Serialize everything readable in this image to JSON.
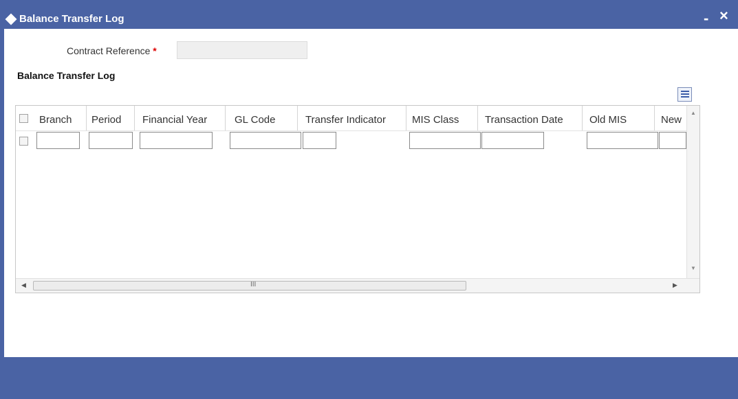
{
  "window": {
    "title": "Balance Transfer Log",
    "minimize_label": "-",
    "close_label": "×"
  },
  "form": {
    "contract_reference_label": "Contract Reference",
    "required_mark": "*",
    "contract_reference_value": ""
  },
  "section": {
    "title": "Balance Transfer Log"
  },
  "grid": {
    "columns": [
      "Branch",
      "Period",
      "Financial Year",
      "GL Code",
      "Transfer Indicator",
      "MIS Class",
      "Transaction Date",
      "Old MIS",
      "New"
    ],
    "rows": [
      {
        "Branch": "",
        "Period": "",
        "Financial Year": "",
        "GL Code": "",
        "Transfer Indicator": "",
        "MIS Class": "",
        "Transaction Date": "",
        "Old MIS": "",
        "New": ""
      }
    ],
    "scrollbar_grip": "III"
  },
  "colors": {
    "accent": "#4a63a4",
    "required": "#dd0000"
  }
}
